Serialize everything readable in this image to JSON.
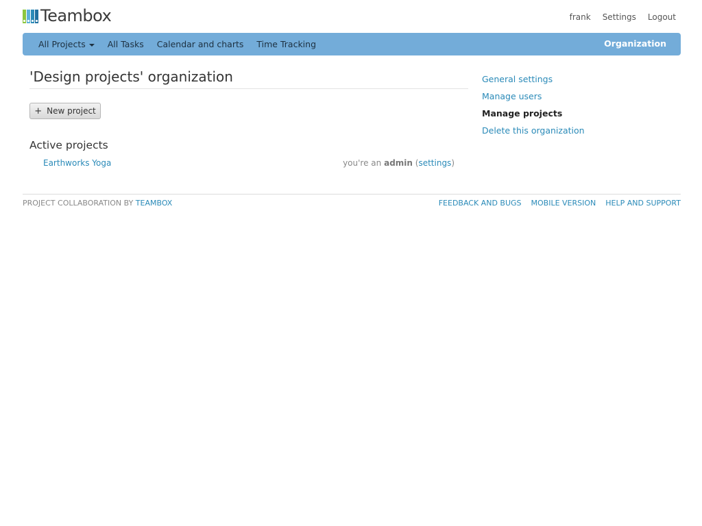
{
  "header": {
    "logo_text": "Teambox",
    "logo_colors": [
      "#8cc63f",
      "#5bb0d8",
      "#2a8ab8",
      "#1e6f9f"
    ],
    "user_links": [
      "frank",
      "Settings",
      "Logout"
    ]
  },
  "nav": {
    "items": [
      "All Projects",
      "All Tasks",
      "Calendar and charts",
      "Time Tracking"
    ],
    "right_label": "Organization",
    "bar_color": "#73acd9"
  },
  "main": {
    "title": "'Design projects' organization",
    "new_project_label": "New project",
    "new_project_icon": "plus-icon",
    "section_title": "Active projects",
    "projects": [
      {
        "name": "Earthworks Yoga",
        "role_prefix": "you're an",
        "role": "admin",
        "settings_label": "settings"
      }
    ]
  },
  "sidebar": {
    "items": [
      "General settings",
      "Manage users",
      "Manage projects",
      "Delete this organization"
    ],
    "active": "Manage projects"
  },
  "footer": {
    "left_text": "PROJECT COLLABORATION BY",
    "left_link": "TEAMBOX",
    "links": [
      "FEEDBACK AND BUGS",
      "MOBILE VERSION",
      "HELP AND SUPPORT"
    ]
  }
}
